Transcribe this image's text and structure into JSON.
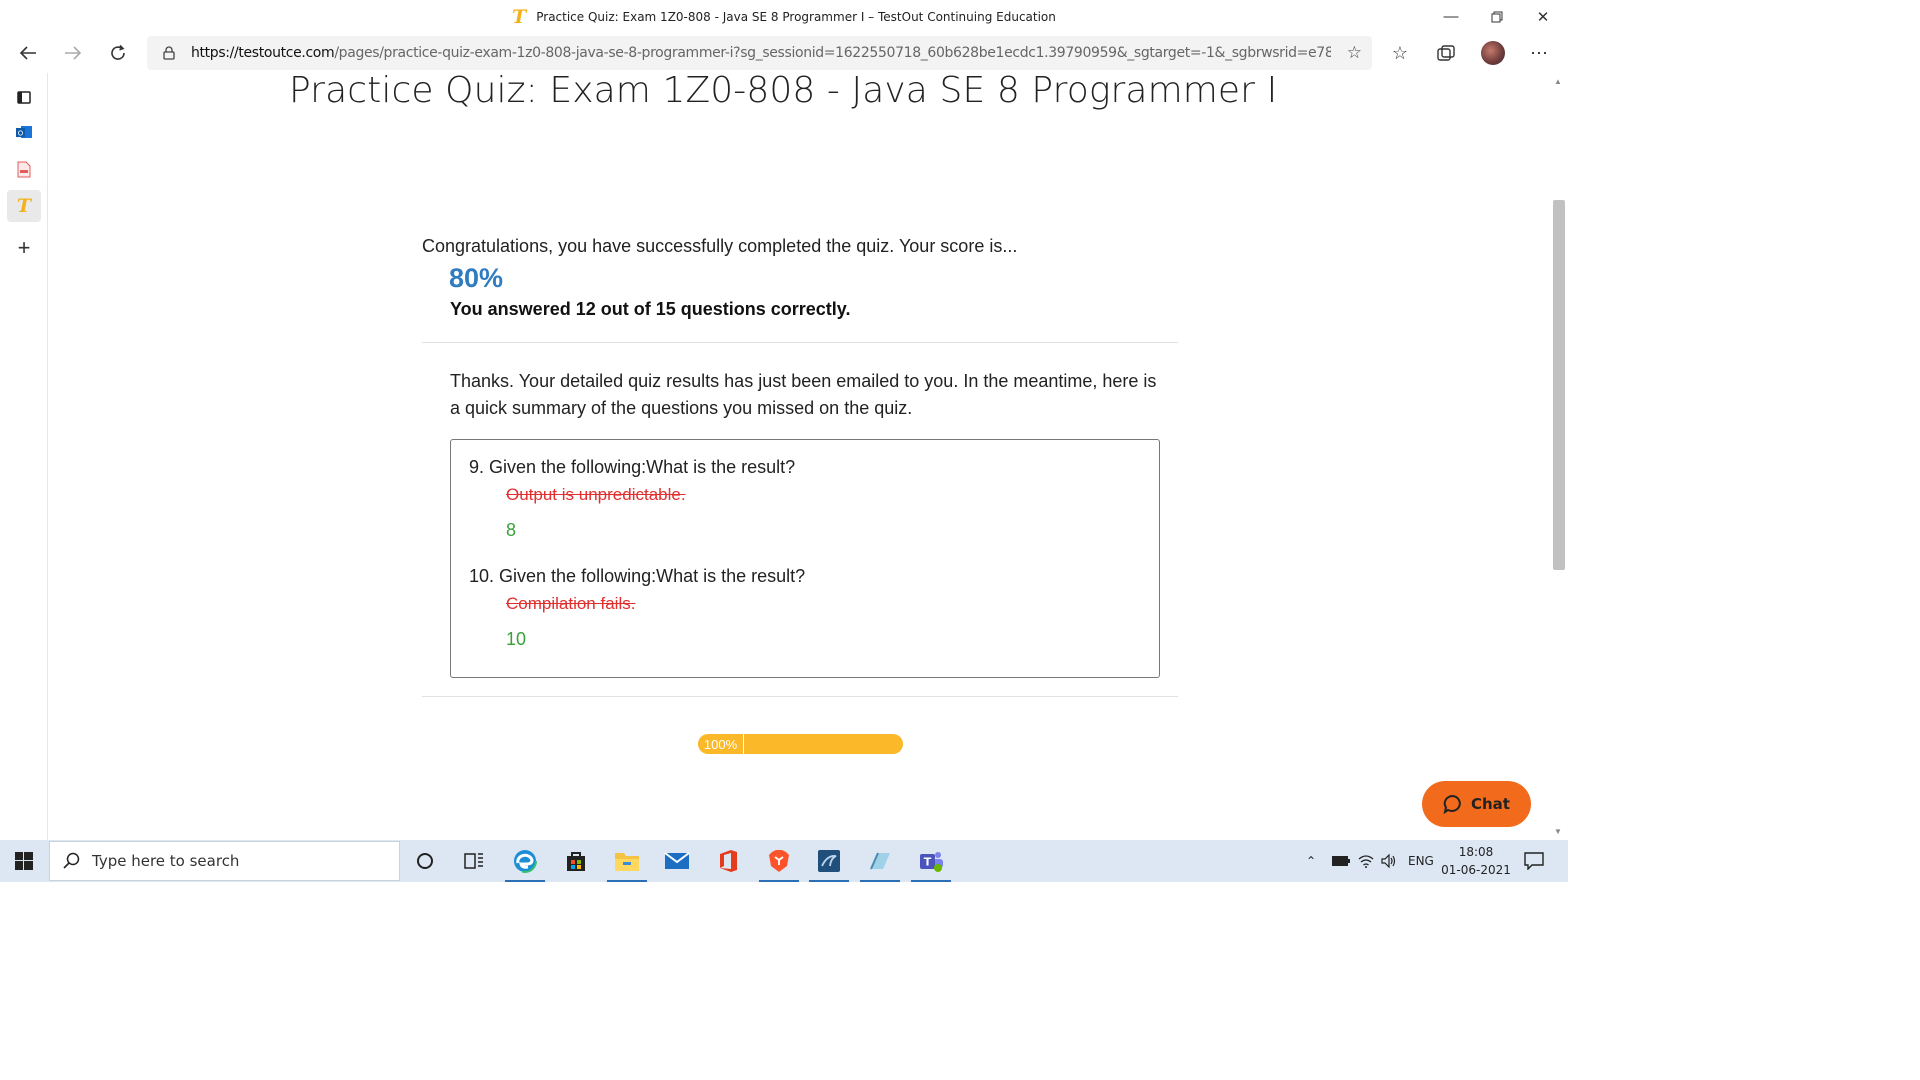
{
  "window": {
    "title": "Practice Quiz: Exam 1Z0-808 - Java SE 8 Programmer I – TestOut Continuing Education",
    "logo": "T"
  },
  "browser": {
    "url_host": "https://testoutce.com",
    "url_rest": "/pages/practice-quiz-exam-1z0-808-java-se-8-programmer-i?sg_sessionid=1622550718_60b628be1ecdc1.39790959&_sgtarget=-1&_sgbrwsrid=e784089f..."
  },
  "page": {
    "title": "Practice Quiz: Exam 1Z0-808 - Java SE 8 Programmer I",
    "congrats": "Congratulations, you have successfully completed the quiz. Your score is...",
    "score": "80%",
    "answered": "You answered 12 out of 15 questions correctly.",
    "thanks": "Thanks. Your detailed quiz results has just been emailed to you. In the meantime, here is a quick summary of the questions you missed on the quiz.",
    "missed": [
      {
        "question": "9. Given the following:What is the result?",
        "your_answer": "Output is unpredictable.",
        "correct_answer": "8"
      },
      {
        "question": "10. Given the following:What is the result?",
        "your_answer": "Compilation fails.",
        "correct_answer": "10"
      }
    ],
    "progress_label": "100%",
    "progress_fraction": 1.0,
    "chat_label": "Chat"
  },
  "taskbar": {
    "search_placeholder": "Type here to search",
    "language": "ENG",
    "time": "18:08",
    "date": "01-06-2021"
  },
  "colors": {
    "score": "#2f7cc1",
    "wrong": "#e03030",
    "right": "#3aa13a",
    "progress": "#fbb829",
    "chat": "#f26b1d"
  }
}
